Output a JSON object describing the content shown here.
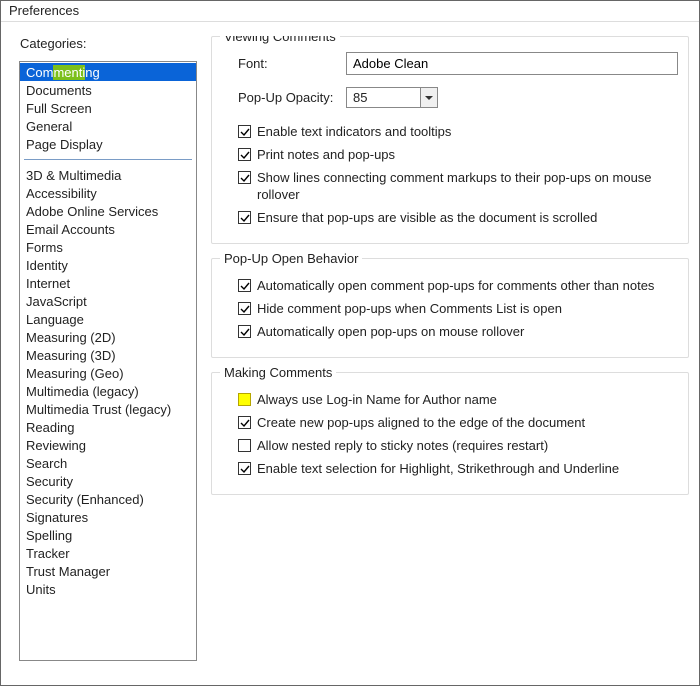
{
  "window": {
    "title": "Preferences"
  },
  "sidebar": {
    "label": "Categories:",
    "group1": [
      "Commenting",
      "Documents",
      "Full Screen",
      "General",
      "Page Display"
    ],
    "group2": [
      "3D & Multimedia",
      "Accessibility",
      "Adobe Online Services",
      "Email Accounts",
      "Forms",
      "Identity",
      "Internet",
      "JavaScript",
      "Language",
      "Measuring (2D)",
      "Measuring (3D)",
      "Measuring (Geo)",
      "Multimedia (legacy)",
      "Multimedia Trust (legacy)",
      "Reading",
      "Reviewing",
      "Search",
      "Security",
      "Security (Enhanced)",
      "Signatures",
      "Spelling",
      "Tracker",
      "Trust Manager",
      "Units"
    ],
    "selected": "Commenting",
    "selected_pre": "Com",
    "selected_hl": "menti",
    "selected_post": "ng"
  },
  "groups": {
    "viewing": {
      "title": "Viewing Comments",
      "font_label": "Font:",
      "font_value": "Adobe Clean",
      "opacity_label": "Pop-Up Opacity:",
      "opacity_value": "85",
      "chk1": "Enable text indicators and tooltips",
      "chk2": "Print notes and pop-ups",
      "chk3": "Show lines connecting comment markups to their pop-ups on mouse rollover",
      "chk4": "Ensure that pop-ups are visible as the document is scrolled"
    },
    "popup": {
      "title": "Pop-Up Open Behavior",
      "chk1": "Automatically open comment pop-ups for comments other than notes",
      "chk2": "Hide comment pop-ups when Comments List is open",
      "chk3": "Automatically open pop-ups on mouse rollover"
    },
    "making": {
      "title": "Making Comments",
      "chk1": "Always use Log-in Name for Author name",
      "chk2": "Create new pop-ups aligned to the edge of the document",
      "chk3": "Allow nested reply to sticky notes (requires restart)",
      "chk4": "Enable text selection for Highlight, Strikethrough and Underline"
    }
  }
}
